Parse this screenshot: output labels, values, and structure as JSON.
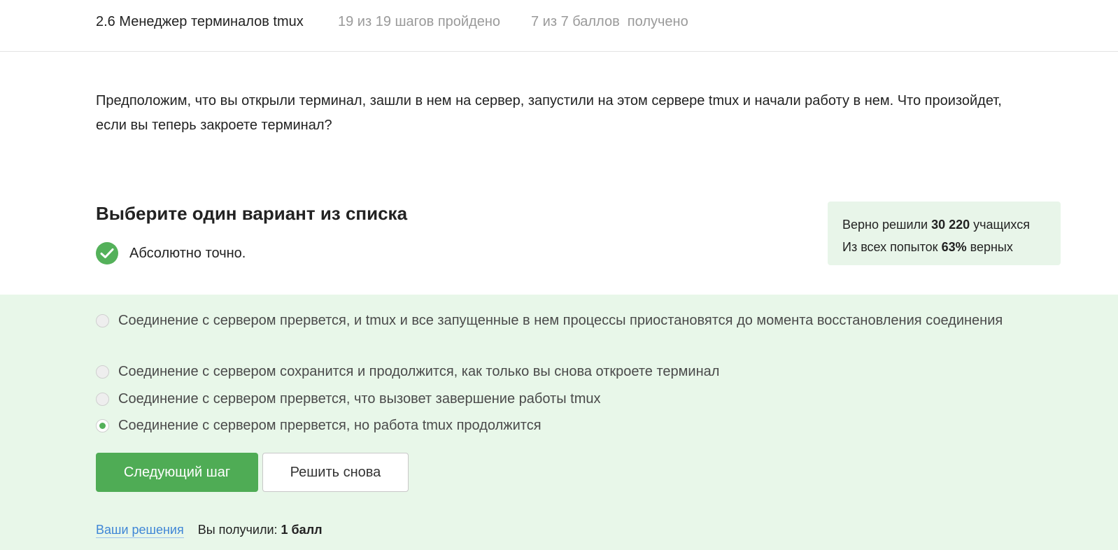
{
  "header": {
    "lesson_title": "2.6 Менеджер терминалов tmux",
    "steps_progress": "19 из 19 шагов пройдено",
    "points_progress": "7 из 7 баллов  получено"
  },
  "question": {
    "text": "Предположим, что вы открыли терминал, зашли в нем на сервер, запустили на этом сервере tmux и начали работу в нем. Что произойдет, если вы теперь закроете терминал?"
  },
  "quiz": {
    "section_title": "Выберите один вариант из списка",
    "feedback_icon": "check-circle-icon",
    "feedback_text": "Абсолютно точно.",
    "options": [
      {
        "label": "Соединение с сервером прервется, и tmux и все запущенные в нем процессы приостановятся до момента восстановления соединения",
        "selected": false
      },
      {
        "label": "Соединение с сервером сохранится и продолжится, как только вы снова откроете терминал",
        "selected": false
      },
      {
        "label": "Соединение с сервером прервется, что вызовет завершение работы tmux",
        "selected": false
      },
      {
        "label": "Соединение с сервером прервется, но работа tmux продолжится",
        "selected": true
      }
    ],
    "next_button": "Следующий шаг",
    "retry_button": "Решить снова"
  },
  "stats": {
    "solved_prefix": "Верно решили",
    "solved_count": "30 220",
    "solved_suffix": "учащихся",
    "attempts_prefix": "Из всех попыток",
    "attempts_percent": "63%",
    "attempts_suffix": "верных"
  },
  "footer": {
    "solutions_link": "Ваши решения",
    "score_label": "Вы получили:",
    "score_value": "1 балл"
  },
  "colors": {
    "accent_green": "#4fac55",
    "answer_bg": "#e8f7e9",
    "stats_bg": "#e8f5e9",
    "link_blue": "#3f86d6"
  }
}
